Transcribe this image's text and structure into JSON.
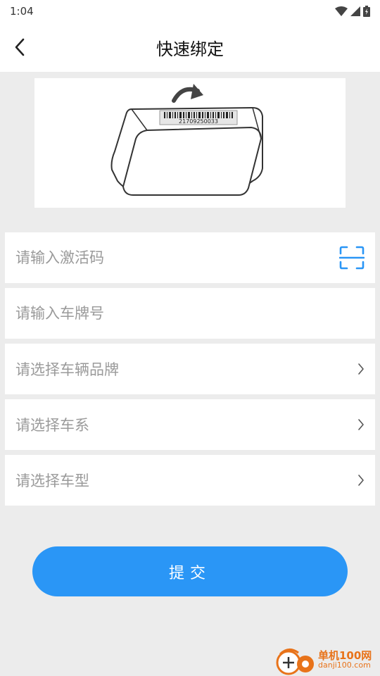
{
  "status_bar": {
    "time": "1:04"
  },
  "header": {
    "title": "快速绑定"
  },
  "device_image": {
    "barcode_number": "21709250033"
  },
  "form": {
    "activation_code_placeholder": "请输入激活码",
    "plate_number_placeholder": "请输入车牌号",
    "brand_label": "请选择车辆品牌",
    "series_label": "请选择车系",
    "model_label": "请选择车型"
  },
  "submit": {
    "label": "提交"
  },
  "watermark": {
    "title": "单机100网",
    "url": "danji100.com"
  },
  "colors": {
    "accent": "#2a96f6",
    "background": "#ececec",
    "watermark": "#e8731a"
  },
  "icons": {
    "back": "chevron-left-icon",
    "scan": "scan-frame-icon",
    "arrow": "chevron-right-icon"
  }
}
